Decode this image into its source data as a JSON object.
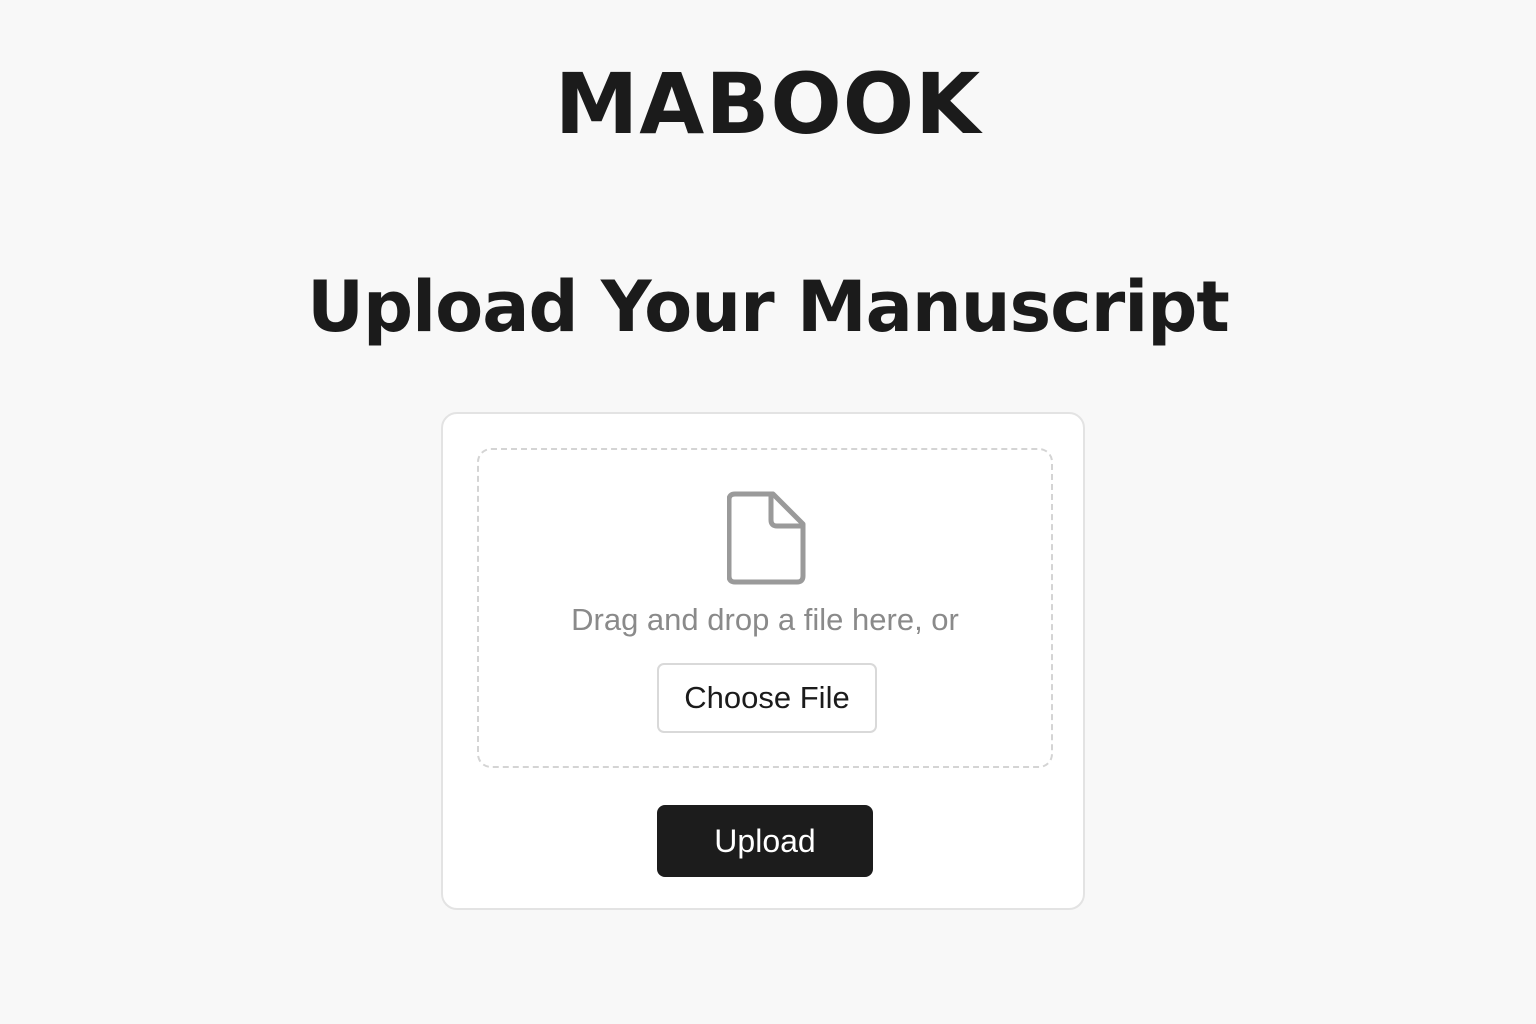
{
  "brand": {
    "logo_text": "MABOOK"
  },
  "page": {
    "title": "Upload Your Manuscript"
  },
  "upload": {
    "file_icon": "document-icon",
    "drop_text": "Drag and drop a file here, or",
    "choose_file_label": "Choose File",
    "upload_label": "Upload"
  },
  "colors": {
    "background": "#f8f8f8",
    "text": "#1b1b1b",
    "muted_text": "#8a8a8a",
    "upload_button": "#1c1c1c"
  }
}
